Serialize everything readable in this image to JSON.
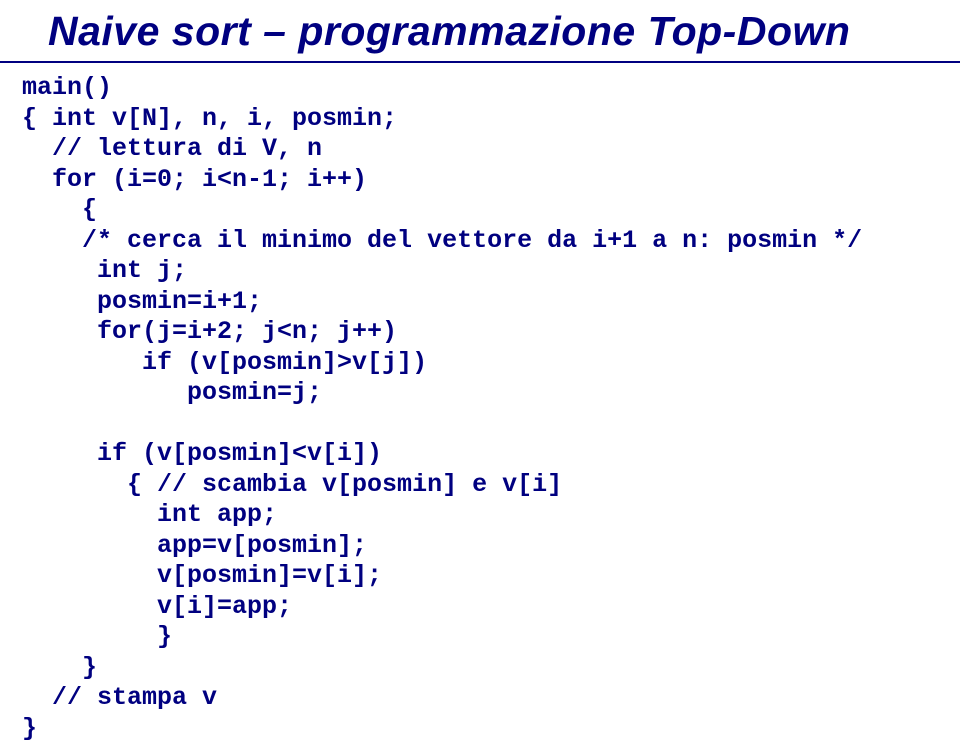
{
  "slide": {
    "title": "Naive sort – programmazione Top-Down",
    "code": "main()\n{ int v[N], n, i, posmin;\n  // lettura di V, n\n  for (i=0; i<n-1; i++)\n    {\n    /* cerca il minimo del vettore da i+1 a n: posmin */\n     int j;\n     posmin=i+1;\n     for(j=i+2; j<n; j++)\n        if (v[posmin]>v[j])\n           posmin=j;\n\n     if (v[posmin]<v[i])\n       { // scambia v[posmin] e v[i]\n         int app;\n         app=v[posmin];\n         v[posmin]=v[i];\n         v[i]=app;\n         }\n    }\n  // stampa v\n}"
  }
}
